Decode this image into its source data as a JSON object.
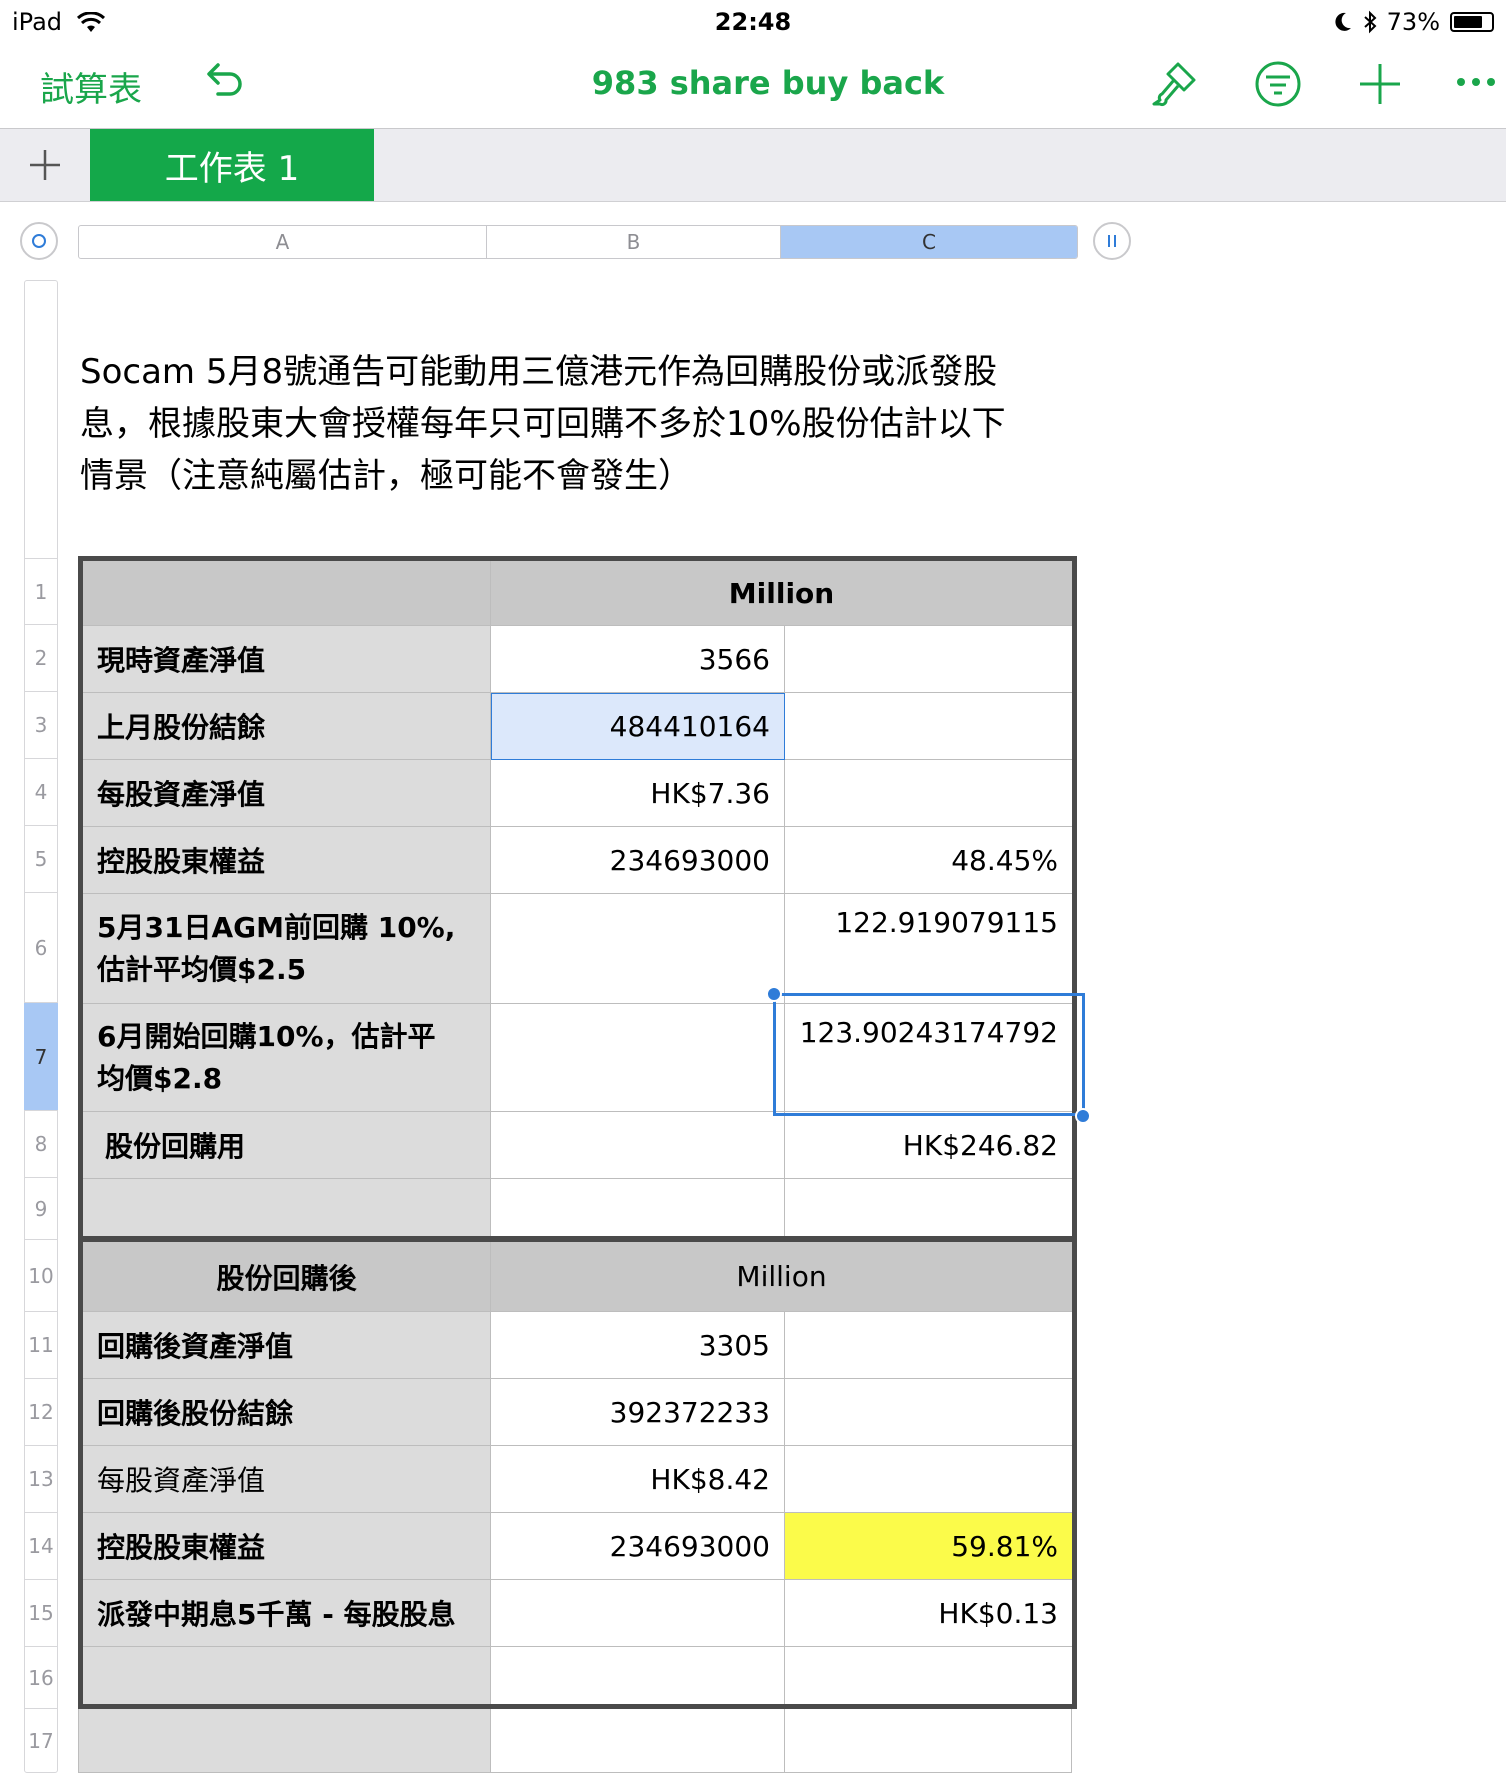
{
  "status_bar": {
    "device": "iPad",
    "time": "22:48",
    "battery": "73%"
  },
  "toolbar": {
    "back_label": "試算表",
    "title": "983 share buy back"
  },
  "sheet_tabs": {
    "active": "工作表 1"
  },
  "columns": [
    "A",
    "B",
    "C"
  ],
  "rows": [
    "1",
    "2",
    "3",
    "4",
    "5",
    "6",
    "7",
    "8",
    "9",
    "10",
    "11",
    "12",
    "13",
    "14",
    "15",
    "16",
    "17"
  ],
  "note": {
    "line1": "Socam 5月8號通告可能動用三億港元作為回購股份或派發股",
    "line2": "息，根據股東大會授權每年只可回購不多於10%股份估計以下",
    "line3": "情景（注意純屬估計，極可能不會發生）"
  },
  "table1": {
    "header": "Million",
    "r2": {
      "label": "現時資產淨值",
      "b": "3566",
      "c": ""
    },
    "r3": {
      "label": "上月股份結餘",
      "b": "484410164",
      "c": ""
    },
    "r4": {
      "label": "每股資產淨值",
      "b": "HK$7.36",
      "c": ""
    },
    "r5": {
      "label": "控股股東權益",
      "b": "234693000",
      "c": "48.45%"
    },
    "r6": {
      "label_line1": "5月31日AGM前回購 10%,",
      "label_line2": "估計平均價$2.5",
      "b": "",
      "c": "122.919079115"
    },
    "r7": {
      "label_line1": "6月開始回購10%，估計平",
      "label_line2": "均價$2.8",
      "b": "",
      "c": "123.90243174792"
    },
    "r8": {
      "label": "股份回購用",
      "b": "",
      "c": "HK$246.82"
    }
  },
  "table2": {
    "header_a": "股份回購後",
    "header_b": "Million",
    "r11": {
      "label": "回購後資產淨值",
      "b": "3305",
      "c": ""
    },
    "r12": {
      "label": "回購後股份結餘",
      "b": "392372233",
      "c": ""
    },
    "r13": {
      "label": "每股資產淨值",
      "b": "HK$8.42",
      "c": ""
    },
    "r14": {
      "label": "控股股東權益",
      "b": "234693000",
      "c": "59.81%"
    },
    "r15": {
      "label": "派發中期息5千萬 - 每股股息",
      "b": "",
      "c": "HK$0.13"
    }
  },
  "colors": {
    "accent": "#1aa64b",
    "selection": "#2f7cd8",
    "highlight": "#fbfb4a"
  }
}
